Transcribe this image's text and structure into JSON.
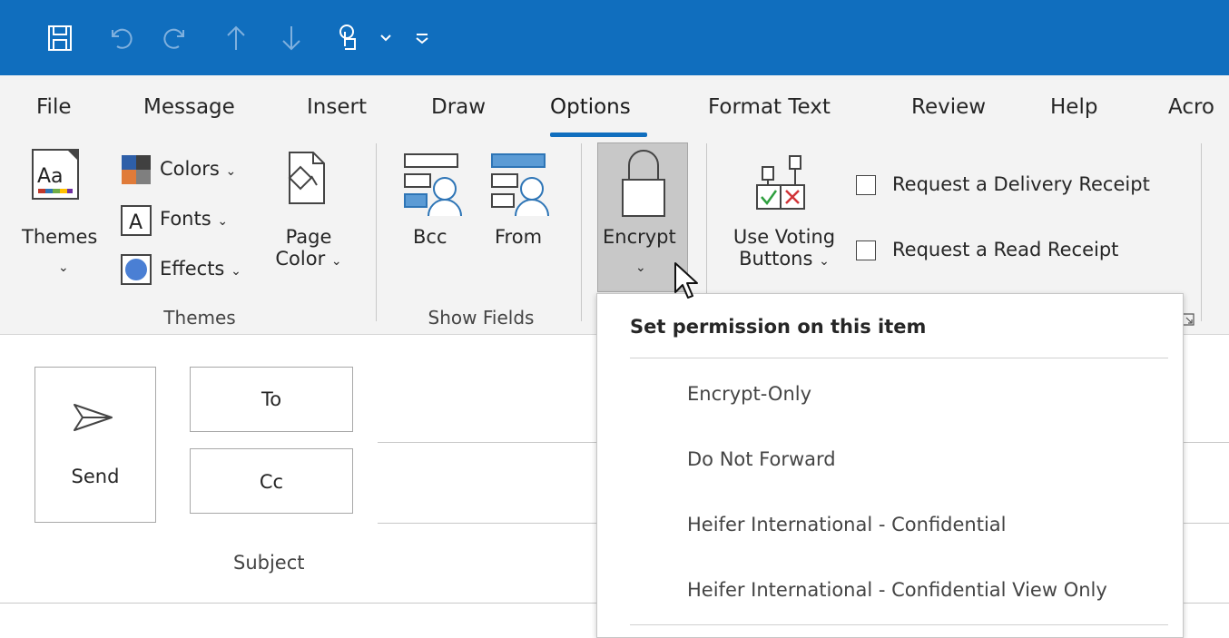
{
  "tabs": [
    "File",
    "Message",
    "Insert",
    "Draw",
    "Options",
    "Format Text",
    "Review",
    "Help",
    "Acro"
  ],
  "active_tab": "Options",
  "ribbon": {
    "themes": {
      "button": "Themes",
      "colors": "Colors",
      "fonts": "Fonts",
      "effects": "Effects",
      "page_color_1": "Page",
      "page_color_2": "Color",
      "group": "Themes"
    },
    "show_fields": {
      "bcc": "Bcc",
      "from": "From",
      "group": "Show Fields"
    },
    "encrypt": {
      "label": "Encrypt"
    },
    "tracking": {
      "voting_1": "Use Voting",
      "voting_2": "Buttons",
      "delivery_receipt": "Request a Delivery Receipt",
      "read_receipt": "Request a Read Receipt"
    }
  },
  "compose": {
    "send": "Send",
    "to": "To",
    "cc": "Cc",
    "subject": "Subject"
  },
  "menu": {
    "header": "Set permission on this item",
    "items": [
      "Encrypt-Only",
      "Do Not Forward",
      "Heifer International - Confidential",
      "Heifer International - Confidential View Only"
    ]
  },
  "colors": {
    "title_bar": "#106ebe",
    "ribbon_bg": "#f3f3f3",
    "accent": "#106ebe",
    "pressed": "#c8c8c8"
  }
}
